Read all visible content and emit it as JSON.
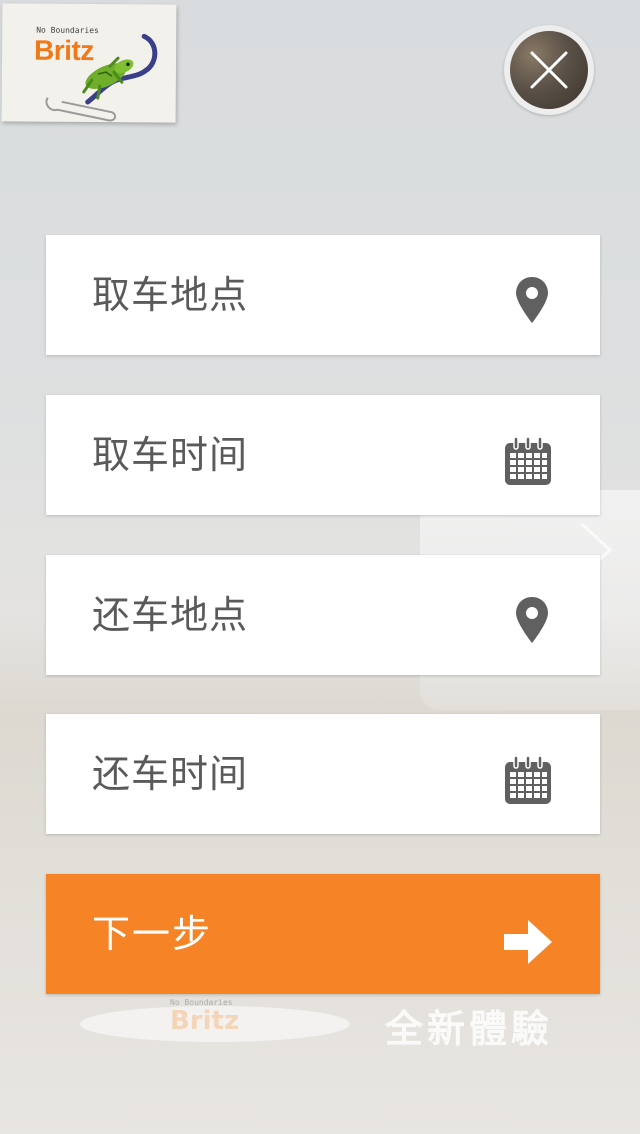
{
  "logo": {
    "tagline": "No Boundaries",
    "brand": "Britz"
  },
  "background": {
    "brand_tagline": "No Boundaries",
    "brand": "Britz",
    "slogan": "全新體驗"
  },
  "close_button": {
    "icon": "close-icon"
  },
  "form": {
    "fields": [
      {
        "label": "取车地点",
        "icon": "location-pin-icon"
      },
      {
        "label": "取车时间",
        "icon": "calendar-icon"
      },
      {
        "label": "还车地点",
        "icon": "location-pin-icon"
      },
      {
        "label": "还车时间",
        "icon": "calendar-icon"
      }
    ],
    "next_button": {
      "label": "下一步",
      "icon": "arrow-right-icon"
    }
  },
  "colors": {
    "accent": "#f68426",
    "field_text": "#5a5a5a",
    "icon": "#606060",
    "brand_orange": "#f07a1a"
  }
}
